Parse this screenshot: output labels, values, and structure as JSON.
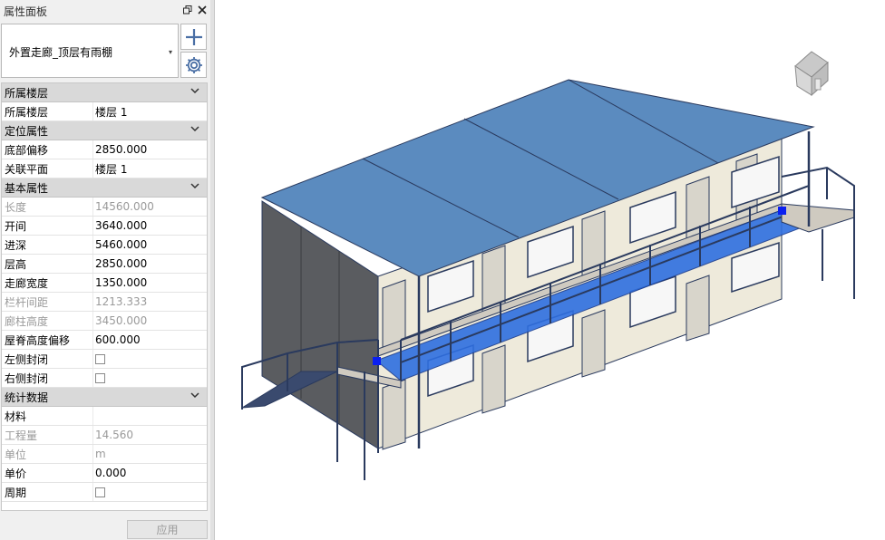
{
  "panel": {
    "title": "属性面板",
    "float_icon": "restore-icon",
    "close_icon": "close-icon",
    "type_selector": {
      "value": "外置走廊_顶层有雨棚",
      "arrow": "▾"
    },
    "apply_label": "应用"
  },
  "sections": {
    "floor": {
      "title": "所属楼层",
      "rows": [
        {
          "label": "所属楼层",
          "value": "楼层 1"
        }
      ]
    },
    "position": {
      "title": "定位属性",
      "rows": [
        {
          "label": "底部偏移",
          "value": "2850.000"
        },
        {
          "label": "关联平面",
          "value": "楼层 1"
        }
      ]
    },
    "basic": {
      "title": "基本属性",
      "rows": [
        {
          "label": "长度",
          "value": "14560.000",
          "readonly": true
        },
        {
          "label": "开间",
          "value": "3640.000"
        },
        {
          "label": "进深",
          "value": "5460.000"
        },
        {
          "label": "层高",
          "value": "2850.000"
        },
        {
          "label": "走廊宽度",
          "value": "1350.000"
        },
        {
          "label": "栏杆间距",
          "value": "1213.333",
          "readonly": true
        },
        {
          "label": "廊柱高度",
          "value": "3450.000",
          "readonly": true
        },
        {
          "label": "屋脊高度偏移",
          "value": "600.000"
        },
        {
          "label": "左侧封闭",
          "checkbox": false
        },
        {
          "label": "右侧封闭",
          "checkbox": false
        }
      ]
    },
    "stats": {
      "title": "统计数据",
      "rows": [
        {
          "label": "材料",
          "value": ""
        },
        {
          "label": "工程量",
          "value": "14.560",
          "readonly": true
        },
        {
          "label": "单位",
          "value": "m",
          "readonly": true
        },
        {
          "label": "单价",
          "value": "0.000"
        },
        {
          "label": "周期",
          "checkbox": false
        }
      ]
    }
  },
  "viewport": {
    "colors": {
      "roof": "#5b8bbf",
      "corridor": "#2f6fe0",
      "wall": "#eeeadb",
      "side": "#5a5c60",
      "steel": "#2a3a5e",
      "selection": "#0a1ff0"
    }
  }
}
